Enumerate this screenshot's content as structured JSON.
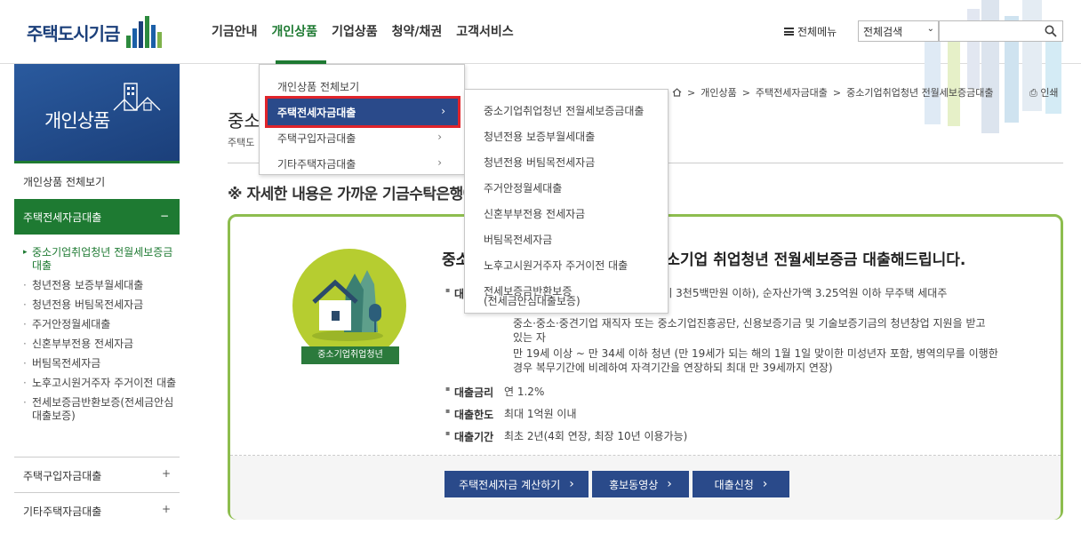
{
  "header": {
    "logo_text": "주택도시기금",
    "nav": [
      "기금안내",
      "개인상품",
      "기업상품",
      "청약/채권",
      "고객서비스"
    ],
    "all_menu": "전체메뉴",
    "search_select": "전체검색",
    "search_value": ""
  },
  "sidebar": {
    "title": "개인상품",
    "all_link": "개인상품 전체보기",
    "active_section": "주택전세자금대출",
    "active_toggle": "−",
    "sub_items": [
      "중소기업취업청년 전월세보증금대출",
      "청년전용 보증부월세대출",
      "청년전용 버팀목전세자금",
      "주거안정월세대출",
      "신혼부부전용 전세자금",
      "버팀목전세자금",
      "노후고시원거주자 주거이전 대출",
      "전세보증금반환보증(전세금안심대출보증)"
    ],
    "sections": [
      {
        "label": "주택구입자금대출",
        "toggle": "+"
      },
      {
        "label": "기타주택자금대출",
        "toggle": "+"
      }
    ]
  },
  "breadcrumb": [
    "개인상품",
    "주택전세자금대출",
    "중소기업취업청년 전월세보증금대출"
  ],
  "print_label": "인쇄",
  "page": {
    "title": "중소",
    "subtitle": "주택도",
    "notice": "※ 자세한 내용은 가까운 기금수탁은행에서 상담받으실 수 있습니다."
  },
  "card": {
    "badge": "중소기업취업청년",
    "heading": "중소기업 취업청년에게 저금리의 중소기업 취업청년 전월세보증금 대출해드립니다.",
    "rows": [
      {
        "key": "대상",
        "value": "부부합산 연소득 5천만원 이하(외벌이 3천5백만원 이하), 순자산가액 3.25억원 이하 무주택 세대주"
      },
      {
        "key": "대출금리",
        "value": "연 1.2%"
      },
      {
        "key": "대출한도",
        "value": "최대 1억원 이내"
      },
      {
        "key": "대출기간",
        "value": "최초 2년(4회 연장, 최장 10년 이용가능)"
      }
    ],
    "detail_lines": [
      "중소·중소·중견기업 재직자 또는 중소기업진흥공단, 신용보증기금 및 기술보증기금의 청년창업 지원을 받고",
      "있는 자",
      "만 19세 이상 ~ 만 34세 이하 청년 (만 19세가 되는 해의 1월 1일 맞이한 미성년자 포함, 병역의무를 이행한",
      "경우 복무기간에 비례하여 자격기간을 연장하되 최대 만 39세까지 연장)"
    ],
    "buttons": [
      "주택전세자금 계산하기",
      "홍보동영상",
      "대출신청"
    ]
  },
  "dropdown1": {
    "items": [
      "개인상품 전체보기",
      "주택전세자금대출",
      "주택구입자금대출",
      "기타주택자금대출"
    ]
  },
  "dropdown2": {
    "items": [
      "중소기업취업청년 전월세보증금대출",
      "청년전용 보증부월세대출",
      "청년전용 버팀목전세자금",
      "주거안정월세대출",
      "신혼부부전용 전세자금",
      "버팀목전세자금",
      "노후고시원거주자 주거이전 대출",
      "전세보증금반환보증",
      "(전세금안심대출보증)"
    ]
  },
  "colors": {
    "navy": "#2a4a8a",
    "green": "#1e7a32",
    "lime": "#b6cd30",
    "highlight": "#e0242b"
  }
}
